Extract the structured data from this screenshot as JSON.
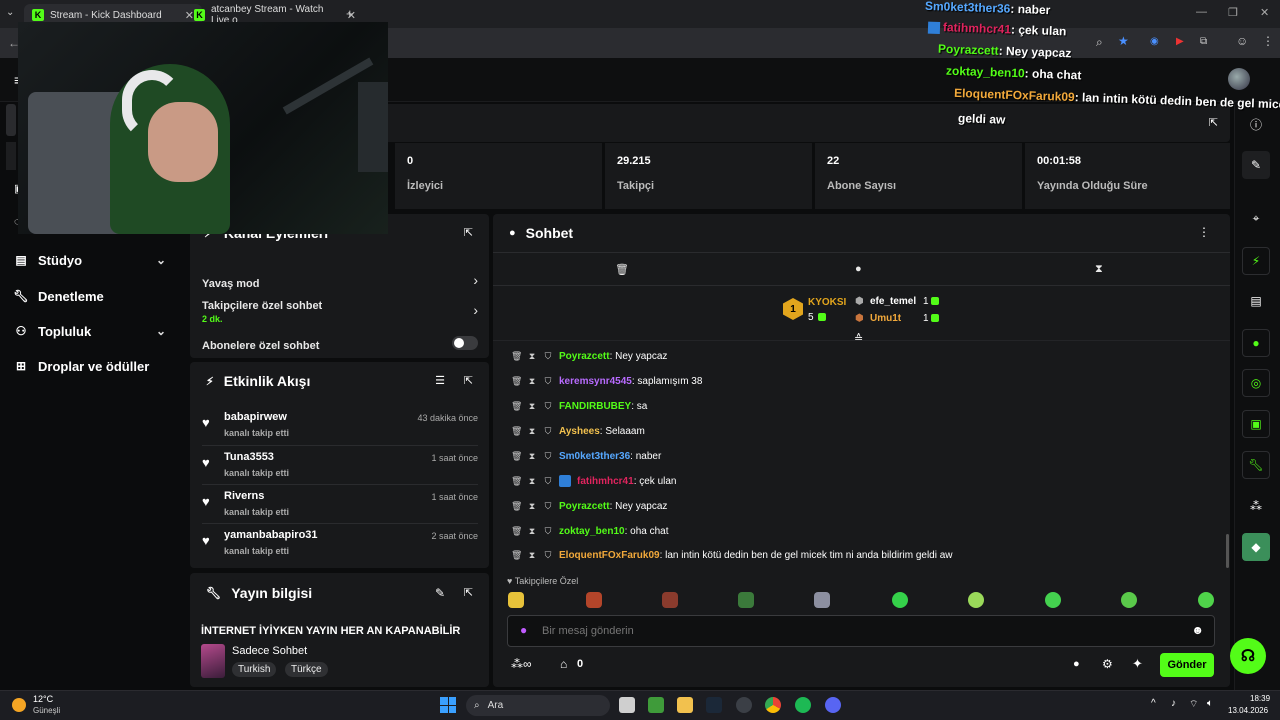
{
  "browser": {
    "tabs": [
      {
        "label": "Stream - Kick Dashboard"
      },
      {
        "label": "atcanbey Stream - Watch Live o"
      }
    ]
  },
  "sidebar": {
    "items": [
      {
        "label": "Stüdyo",
        "icon": "studio-icon",
        "has_chevron": true
      },
      {
        "label": "Denetleme",
        "icon": "wrench-icon",
        "has_chevron": false
      },
      {
        "label": "Topluluk",
        "icon": "community-icon",
        "has_chevron": true
      },
      {
        "label": "Droplar ve ödüller",
        "icon": "gift-icon",
        "has_chevron": false
      }
    ]
  },
  "stats": [
    {
      "value": "0",
      "label": "İzleyici"
    },
    {
      "value": "29.215",
      "label": "Takipçi"
    },
    {
      "value": "22",
      "label": "Abone Sayısı"
    },
    {
      "value": "00:01:58",
      "label": "Yayında Olduğu Süre"
    }
  ],
  "channel_actions": {
    "title": "Kanal Eylemleri",
    "slow_mode": "Yavaş mod",
    "followers_only": "Takipçilere özel sohbet",
    "followers_only_value": "2 dk.",
    "subscribers_only": "Abonelere özel sohbet"
  },
  "activity": {
    "title": "Etkinlik Akışı",
    "events": [
      {
        "name": "babapirwew",
        "sub": "kanalı takip etti",
        "time": "43 dakika önce"
      },
      {
        "name": "Tuna3553",
        "sub": "kanalı takip etti",
        "time": "1 saat önce"
      },
      {
        "name": "Riverns",
        "sub": "kanalı takip etti",
        "time": "1 saat önce"
      },
      {
        "name": "yamanbabapiro31",
        "sub": "kanalı takip etti",
        "time": "2 saat önce"
      }
    ]
  },
  "stream_info": {
    "title": "Yayın bilgisi",
    "stream_title": "İNTERNET İYİYKEN YAYIN HER AN KAPANABİLİR",
    "category": "Sadece Sohbet",
    "tags": [
      "Turkish",
      "Türkçe"
    ]
  },
  "chat": {
    "title": "Sohbet",
    "leaderboard": {
      "first": {
        "name": "KYOKSI",
        "count": "5",
        "rank": "1"
      },
      "second": {
        "name": "efe_temel",
        "count": "1"
      },
      "third": {
        "name": "Umu1t",
        "count": "1"
      }
    },
    "messages": [
      {
        "user": "Poyrazcett",
        "text": ": Ney yapcaz",
        "color": "#53fc18"
      },
      {
        "user": "keremsynr4545",
        "text": ": saplamışım 38",
        "color": "#b86bff"
      },
      {
        "user": "FANDIRBUBEY",
        "text": ": sa",
        "color": "#53fc18"
      },
      {
        "user": "Ayshees",
        "text": ": Selaaam",
        "color": "#f2c14e"
      },
      {
        "user": "Sm0ket3ther36",
        "text": ": naber",
        "color": "#56a8ff"
      },
      {
        "user": "fatihmhcr41",
        "text": ": çek ulan",
        "color": "#e0245e"
      },
      {
        "user": "Poyrazcett",
        "text": ": Ney yapcaz",
        "color": "#53fc18"
      },
      {
        "user": "zoktay_ben10",
        "text": ": oha chat",
        "color": "#53fc18"
      },
      {
        "user": "EloquentFOxFaruk09",
        "text": ": lan intin kötü dedin ben de gel micek tim ni anda bildirim geldi aw",
        "color": "#f2a93b"
      }
    ],
    "emote_section": "Takipçilere Özel",
    "input_placeholder": "Bir mesaj gönderin",
    "points": "0",
    "send_label": "Gönder"
  },
  "overlay_chat": [
    {
      "user": "Sm0ket3ther36",
      "text": ": naber",
      "color": "#56a8ff"
    },
    {
      "user": "fatihmhcr41",
      "text": ": çek ulan",
      "color": "#e0245e"
    },
    {
      "user": "Poyrazcett",
      "text": ": Ney yapcaz",
      "color": "#53fc18"
    },
    {
      "user": "zoktay_ben10",
      "text": ": oha chat",
      "color": "#53fc18"
    },
    {
      "user": "EloquentFOxFaruk09",
      "text": ": lan intin kötü dedin ben de gel micek ti",
      "color": "#f2a93b"
    },
    {
      "user": "",
      "text": "geldi aw",
      "color": "#ffffff"
    }
  ],
  "taskbar": {
    "weather_temp": "12°C",
    "weather_desc": "Güneşli",
    "search": "Ara",
    "time": "18:39",
    "date": "13.04.2026"
  }
}
